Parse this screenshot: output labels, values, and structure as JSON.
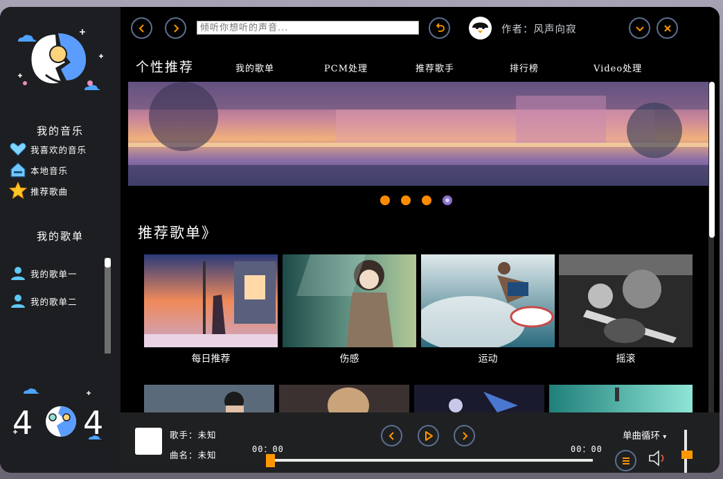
{
  "sidebar": {
    "my_music_title": "我的音乐",
    "my_music_items": [
      {
        "label": "我喜欢的音乐",
        "icon": "heart-icon"
      },
      {
        "label": "本地音乐",
        "icon": "home-icon"
      },
      {
        "label": "推荐歌曲",
        "icon": "star-icon"
      }
    ],
    "playlists_title": "我的歌单",
    "playlist_items": [
      {
        "label": "我的歌单一",
        "icon": "user-icon"
      },
      {
        "label": "我的歌单二",
        "icon": "user-icon"
      }
    ]
  },
  "topbar": {
    "search_placeholder": "倾听你想听的声音...",
    "author": "作者：风声向寂"
  },
  "nav": {
    "main": "个性推荐",
    "tabs": [
      "我的歌单",
      "PCM处理",
      "推荐歌手",
      "排行榜",
      "Video处理"
    ]
  },
  "banner": {
    "dots": 4,
    "active_dot": 4
  },
  "recommend": {
    "title": "推荐歌单》",
    "cards": [
      "每日推荐",
      "伤感",
      "运动",
      "摇滚"
    ]
  },
  "player": {
    "singer": "歌手：未知",
    "song": "曲名：未知",
    "time_current": "00：00",
    "time_total": "00：00",
    "loop_mode": "单曲循环",
    "loop_arrow": "▾"
  },
  "colors": {
    "accent": "#ff9800",
    "dot": "#ff8c00",
    "icon_border": "#5b6f8f",
    "sidebar": "#1d1e21"
  }
}
